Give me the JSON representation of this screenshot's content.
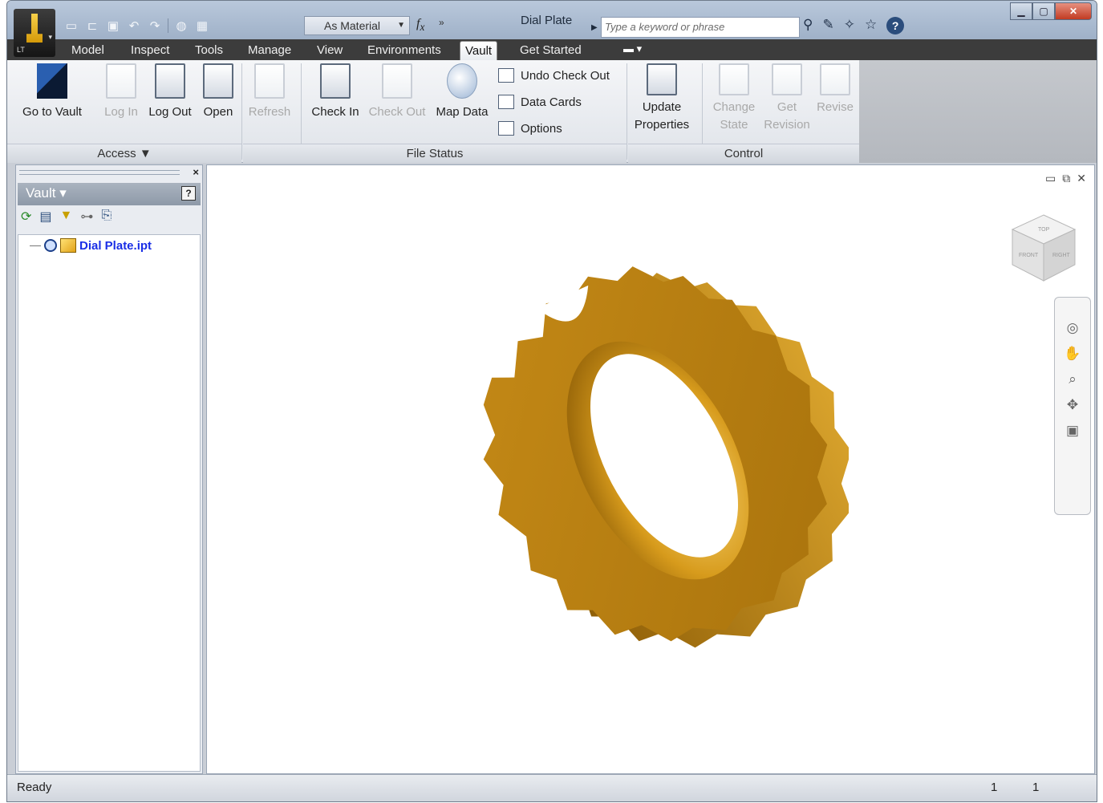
{
  "title_bar": {
    "document_title": "Dial Plate",
    "material_value": "As Material",
    "search_placeholder": "Type a keyword or phrase",
    "app_badge": "LT"
  },
  "qat_icons": [
    "new-icon",
    "open-icon",
    "save-icon",
    "undo-icon",
    "redo-icon",
    "appearance-icon",
    "update-icon"
  ],
  "menu_tabs": [
    "Model",
    "Inspect",
    "Tools",
    "Manage",
    "View",
    "Environments",
    "Vault",
    "Get Started"
  ],
  "active_tab": "Vault",
  "ribbon": {
    "access": {
      "go_to_vault": "Go to Vault",
      "log_in": "Log In",
      "log_out": "Log Out",
      "open": "Open",
      "panel_label": "Access ▼"
    },
    "file_status": {
      "refresh": "Refresh",
      "check_in": "Check In",
      "check_out": "Check Out",
      "map_data": "Map Data",
      "undo_check_out": "Undo Check Out",
      "data_cards": "Data Cards",
      "options": "Options",
      "panel_label": "File Status"
    },
    "control": {
      "update_properties_1": "Update",
      "update_properties_2": "Properties",
      "change_state_1": "Change",
      "change_state_2": "State",
      "get_revision_1": "Get",
      "get_revision_2": "Revision",
      "revise": "Revise",
      "panel_label": "Control"
    }
  },
  "browser": {
    "title": "Vault",
    "help": "?",
    "tree_item": "Dial Plate.ipt"
  },
  "viewcube": {
    "top": "TOP",
    "front": "FRONT",
    "right": "RIGHT"
  },
  "status_bar": {
    "text": "Ready",
    "count_1": "1",
    "count_2": "1"
  },
  "colors": {
    "part_gold": "#c68a14",
    "ribbon_dark": "#3c3c3c",
    "link_blue": "#1a2ee6"
  }
}
